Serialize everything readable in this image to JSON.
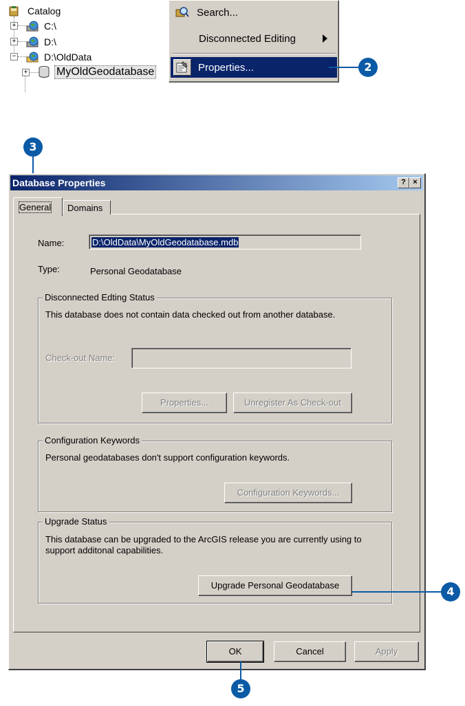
{
  "catalog_tree": {
    "root_label": "Catalog",
    "items": [
      {
        "label": "C:\\"
      },
      {
        "label": "D:\\"
      },
      {
        "label": "D:\\OldData"
      }
    ],
    "selected_label": "MyOldGeodatabase"
  },
  "context_menu": {
    "items": [
      {
        "label": "Search...",
        "accel": "S"
      },
      {
        "label": "Disconnected Editing"
      },
      {
        "label": "Properties...",
        "highlighted": true
      }
    ]
  },
  "callouts": {
    "step2": "2",
    "step3": "3",
    "step4": "4",
    "step5": "5"
  },
  "dialog": {
    "title": "Database Properties",
    "help_button": "?",
    "close_button": "×",
    "tabs": [
      {
        "label": "General",
        "active": true
      },
      {
        "label": "Domains",
        "active": false
      }
    ],
    "name_label": "Name:",
    "name_value": "D:\\OldData\\MyOldGeodatabase.mdb",
    "type_label": "Type:",
    "type_value": "Personal Geodatabase",
    "disconnected": {
      "legend": "Disconnected Edting Status",
      "description": "This database does not contain data checked out from another database.",
      "checkout_label": "Check-out Name:",
      "checkout_value": "",
      "properties_button": "Properties...",
      "unregister_button": "Unregister As Check-out"
    },
    "config": {
      "legend": "Configuration Keywords",
      "description": "Personal geodatabases don't support configuration keywords.",
      "button": "Configuration Keywords..."
    },
    "upgrade": {
      "legend": "Upgrade Status",
      "description": "This database can be upgraded to the ArcGIS release you are currently using to support additonal capabilities.",
      "button": "Upgrade Personal Geodatabase"
    },
    "footer": {
      "ok": "OK",
      "cancel": "Cancel",
      "apply": "Apply"
    }
  },
  "colors": {
    "highlight": "#0a246a",
    "callout": "#0b5aa6",
    "dialog_face": "#d4d0c8"
  }
}
